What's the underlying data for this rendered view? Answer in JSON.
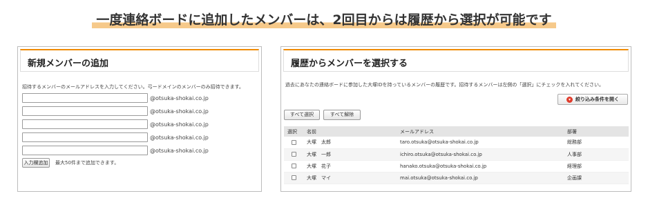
{
  "headline": "一度連絡ボードに追加したメンバーは、2回目からは履歴から選択が可能です",
  "colors": {
    "accent": "#f08a00",
    "highlight": "#f6c98a",
    "filter_icon": "#e03c2c"
  },
  "left_panel": {
    "title": "新規メンバーの追加",
    "description": "招待するメンバーのメールアドレスを入力してください。弓ードメインのメンバーのみ招待できます。",
    "email_rows": [
      {
        "value": "",
        "domain": "@otsuka-shokai.co.jp"
      },
      {
        "value": "",
        "domain": "@otsuka-shokai.co.jp"
      },
      {
        "value": "",
        "domain": "@otsuka-shokai.co.jp"
      },
      {
        "value": "",
        "domain": "@otsuka-shokai.co.jp"
      },
      {
        "value": "",
        "domain": "@otsuka-shokai.co.jp"
      }
    ],
    "add_field_button": "入力欄追加",
    "limit_note": "最大50件まで追加できます。"
  },
  "right_panel": {
    "title": "履歴からメンバーを選択する",
    "description": "過去にあなたの連絡ボードに参加した大塚IDを持っているメンバーの履歴です。招待するメンバーは左側の「選択」にチェックを入れてください。",
    "filter_button": "絞り込み条件を開く",
    "filter_icon": "chevron-down-icon",
    "select_all_button": "すべて選択",
    "deselect_all_button": "すべて解除",
    "table": {
      "headers": {
        "select": "選択",
        "name": "名前",
        "email": "メールアドレス",
        "dept": "部署"
      },
      "rows": [
        {
          "name": "大塚　太郎",
          "email": "taro.otsuka@otsuka-shokai.co.jp",
          "dept": "総務部"
        },
        {
          "name": "大塚　一郎",
          "email": "ichiro.otsuka@otsuka-shokai.co.jp",
          "dept": "人事部"
        },
        {
          "name": "大塚　花子",
          "email": "hanako.otsuka@otsuka-shokai.co.jp",
          "dept": "経理部"
        },
        {
          "name": "大塚　マイ",
          "email": "mai.otsuka@otsuka-shokai.co.jp",
          "dept": "企画課"
        }
      ]
    }
  }
}
